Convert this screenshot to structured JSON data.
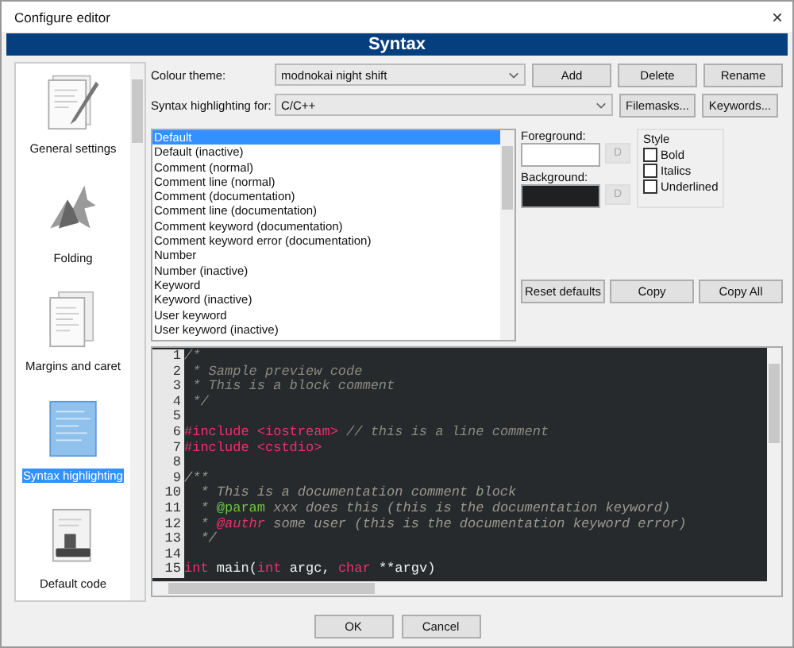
{
  "window": {
    "title": "Configure editor",
    "close": "×"
  },
  "header": "Syntax",
  "sidebar": {
    "items": [
      {
        "label": "General settings",
        "selected": false
      },
      {
        "label": "Folding",
        "selected": false
      },
      {
        "label": "Margins and caret",
        "selected": false
      },
      {
        "label": "Syntax highlighting",
        "selected": true
      },
      {
        "label": "Default code",
        "selected": false
      }
    ]
  },
  "theme": {
    "label": "Colour theme:",
    "value": "modnokai night shift",
    "buttons": [
      "Add",
      "Delete",
      "Rename"
    ]
  },
  "language": {
    "label": "Syntax highlighting for:",
    "value": "C/C++",
    "buttons": [
      "Filemasks...",
      "Keywords..."
    ]
  },
  "styles": [
    {
      "label": "Default",
      "selected": true
    },
    {
      "label": "Default (inactive)",
      "selected": false
    },
    {
      "label": "Comment (normal)",
      "selected": false
    },
    {
      "label": "Comment line (normal)",
      "selected": false
    },
    {
      "label": "Comment (documentation)",
      "selected": false
    },
    {
      "label": "Comment line (documentation)",
      "selected": false
    },
    {
      "label": "Comment keyword (documentation)",
      "selected": false
    },
    {
      "label": "Comment keyword error (documentation)",
      "selected": false
    },
    {
      "label": "Number",
      "selected": false
    },
    {
      "label": "Number (inactive)",
      "selected": false
    },
    {
      "label": "Keyword",
      "selected": false
    },
    {
      "label": "Keyword (inactive)",
      "selected": false
    },
    {
      "label": "User keyword",
      "selected": false
    },
    {
      "label": "User keyword (inactive)",
      "selected": false
    }
  ],
  "colors": [
    {
      "label": "Foreground:",
      "color": "#ffffff",
      "reset": "D"
    },
    {
      "label": "Background:",
      "color": "#1e2022",
      "reset": "D"
    }
  ],
  "style_group": {
    "title": "Style",
    "options": [
      {
        "label": "Bold",
        "checked": false
      },
      {
        "label": "Italics",
        "checked": false
      },
      {
        "label": "Underlined",
        "checked": false
      }
    ]
  },
  "actions": [
    "Reset defaults",
    "Copy",
    "Copy All"
  ],
  "code": [
    {
      "number": "1",
      "segments": [
        {
          "kind": "comment",
          "text": "/*"
        }
      ]
    },
    {
      "number": "2",
      "segments": [
        {
          "kind": "comment",
          "text": " * Sample preview code"
        }
      ]
    },
    {
      "number": "3",
      "segments": [
        {
          "kind": "comment",
          "text": " * This is a block comment"
        }
      ]
    },
    {
      "number": "4",
      "segments": [
        {
          "kind": "comment",
          "text": " */"
        }
      ]
    },
    {
      "number": "5"
    },
    {
      "number": "6",
      "segments": [
        {
          "kind": "preprocessor",
          "text": "#include <iostream>"
        },
        {
          "kind": "comment",
          "text": " // this is a line comment"
        }
      ]
    },
    {
      "number": "7",
      "segments": [
        {
          "kind": "preprocessor",
          "text": "#include <cstdio>"
        }
      ]
    },
    {
      "number": "8"
    },
    {
      "number": "9",
      "segments": [
        {
          "kind": "doc",
          "text": "/**"
        }
      ]
    },
    {
      "number": "10",
      "segments": [
        {
          "kind": "doc",
          "text": "  * This is a documentation comment block"
        }
      ]
    },
    {
      "number": "11",
      "segments": [
        {
          "kind": "doc",
          "text": "  * "
        },
        {
          "kind": "dockeyword",
          "text": "@param"
        },
        {
          "kind": "doc",
          "text": " xxx does this (this is the documentation keyword)"
        }
      ]
    },
    {
      "number": "12",
      "segments": [
        {
          "kind": "doc",
          "text": "  * "
        },
        {
          "kind": "docerror",
          "text": "@authr"
        },
        {
          "kind": "doc",
          "text": " some user (this is the documentation keyword error)"
        }
      ]
    },
    {
      "number": "13",
      "segments": [
        {
          "kind": "doc",
          "text": "  */"
        }
      ]
    },
    {
      "number": "14"
    },
    {
      "number": "15",
      "segments": [
        {
          "kind": "keyword",
          "text": "int"
        },
        {
          "kind": "default",
          "text": " main("
        },
        {
          "kind": "keyword",
          "text": "int"
        },
        {
          "kind": "default",
          "text": " argc, "
        },
        {
          "kind": "keyword",
          "text": "char"
        },
        {
          "kind": "default",
          "text": " **argv)"
        }
      ]
    }
  ],
  "footer_buttons": [
    "OK",
    "Cancel"
  ]
}
